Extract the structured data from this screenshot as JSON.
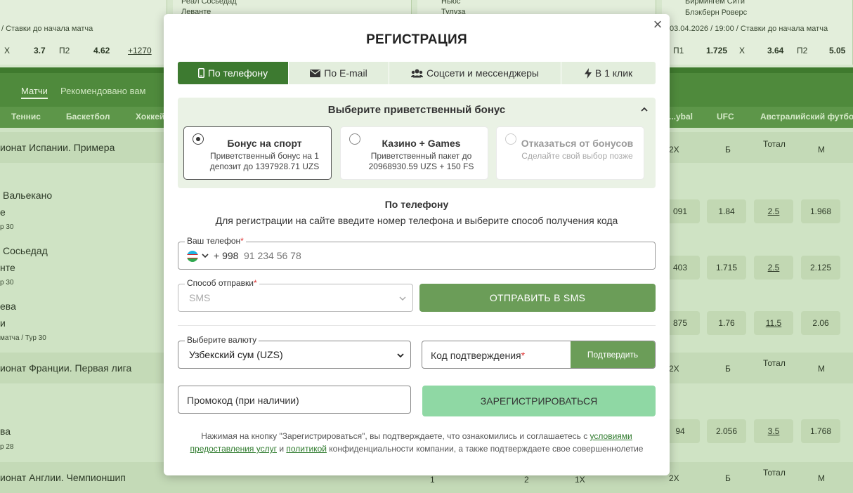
{
  "background": {
    "top_cards": [
      {
        "meta": "/ Ставки до начала матча",
        "outcomes": [
          {
            "label": "X",
            "value": "3.7"
          },
          {
            "label": "П2",
            "value": "4.62"
          },
          {
            "label": "",
            "value": "+1270"
          }
        ]
      },
      {
        "meta": "03.04.2026 / 19:00 / Ставки до начала матча",
        "teams": [
          "Бирмингем Сити",
          "Блэкберн Роверс"
        ],
        "outcomes": [
          {
            "label": "П1",
            "value": "1.725"
          },
          {
            "label": "X",
            "value": "3.64"
          },
          {
            "label": "П2",
            "value": "5.05"
          }
        ]
      }
    ],
    "top_teams_left": [
      "Реал Сосьедад",
      "Леванте"
    ],
    "top_teams_mid": [
      "Ньюс",
      "Тулуза"
    ],
    "nav_tabs": [
      "Матчи",
      "Рекомендовано вам"
    ],
    "sports_left": [
      "Теннис",
      "Баскетбол",
      "Хоккей"
    ],
    "sports_right": [
      "...ybal",
      "UFC",
      "Австралийский футбол"
    ],
    "leagues": [
      {
        "title": "ионат Испании. Примера"
      },
      {
        "title": "ионат Франции. Первая лига"
      },
      {
        "title": "ионат Англии. Чемпионшип"
      }
    ],
    "col_headers": [
      "2X",
      "Б",
      "Тотал",
      "М"
    ],
    "matches": [
      {
        "team1": "Вальекано",
        "team2": "е",
        "info": "р 30",
        "odds": [
          "091",
          "1.84",
          "2.5",
          "1.968"
        ]
      },
      {
        "team1": "Сосьедад",
        "team2": "нте",
        "info": "р 30",
        "odds": [
          "403",
          "1.715",
          "2.5",
          "2.125"
        ]
      },
      {
        "team1": "ева",
        "team2": "и",
        "info": "матча / Тур 30",
        "odds": [
          "875",
          "1.76",
          "11.5",
          "2.06"
        ]
      },
      {
        "team1": "ва",
        "team2": "",
        "info": "р 28",
        "odds": [
          "94",
          "2.056",
          "3.5",
          "1.768"
        ]
      }
    ],
    "bottom_nums": [
      "1",
      "2",
      "1X"
    ]
  },
  "modal": {
    "title": "РЕГИСТРАЦИЯ",
    "close": "×",
    "tabs": [
      {
        "label": "По телефону",
        "icon": "phone-icon",
        "active": true
      },
      {
        "label": "По E-mail",
        "icon": "mail-icon",
        "active": false
      },
      {
        "label": "Соцсети и мессенджеры",
        "icon": "users-icon",
        "active": false
      },
      {
        "label": "В 1 клик",
        "icon": "lightning-icon",
        "active": false
      }
    ],
    "bonus": {
      "heading": "Выберите приветственный бонус",
      "options": [
        {
          "title": "Бонус на спорт",
          "text": "Приветственный бонус на 1 депозит до 1397928.71 UZS",
          "selected": true
        },
        {
          "title": "Казино + Games",
          "text": "Приветственный пакет до 20968930.59 UZS + 150 FS",
          "selected": false
        },
        {
          "title": "Отказаться от бонусов",
          "text": "Сделайте свой выбор позже",
          "selected": false
        }
      ]
    },
    "section_title": "По телефону",
    "section_hint": "Для регистрации на сайте введите номер телефона и выберите способ получения кода",
    "phone": {
      "label": "Ваш телефон",
      "code": "+ 998",
      "placeholder": "91 234 56 78"
    },
    "method": {
      "label": "Способ отправки",
      "value": "SMS"
    },
    "send_sms": "ОТПРАВИТЬ В SMS",
    "currency": {
      "label": "Выберите валюту",
      "value": "Узбекский сум (UZS)"
    },
    "confirm": {
      "placeholder": "Код подтверждения",
      "button": "Подтвердить"
    },
    "promo": {
      "placeholder": "Промокод (при наличии)"
    },
    "register": "ЗАРЕГИСТРИРОВАТЬСЯ",
    "terms": {
      "part1": "Нажимая на кнопку \"Зарегистрироваться\", вы подтверждаете, что ознакомились и соглашаетесь с ",
      "link1": "условиями предоставления услуг",
      "part2": " и ",
      "link2": "политикой",
      "part3": " конфиденциальности компании, а также подтверждаете свое совершеннолетие"
    },
    "colors": {
      "accent": "#3d7a30",
      "button": "#6b9d58",
      "register": "#8fd8a4"
    }
  }
}
